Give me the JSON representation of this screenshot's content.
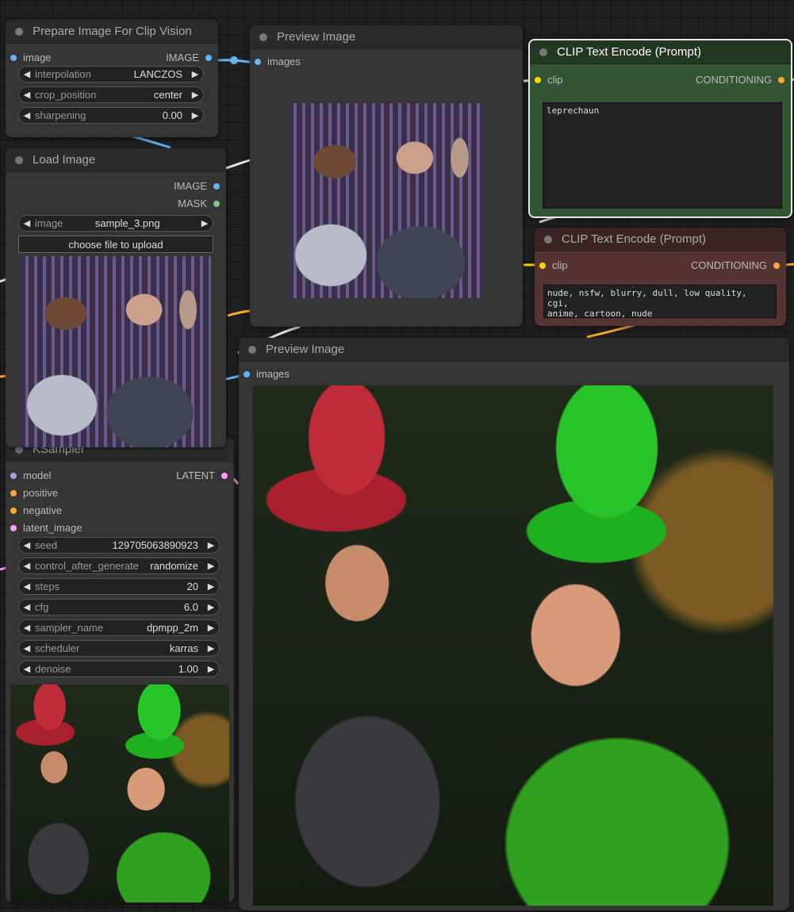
{
  "nodes": {
    "prepare_clip": {
      "title": "Prepare Image For Clip Vision",
      "input_image": "image",
      "output_image": "IMAGE",
      "widgets": [
        {
          "label": "interpolation",
          "value": "LANCZOS"
        },
        {
          "label": "crop_position",
          "value": "center"
        },
        {
          "label": "sharpening",
          "value": "0.00"
        }
      ]
    },
    "load_image": {
      "title": "Load Image",
      "output_image": "IMAGE",
      "output_mask": "MASK",
      "widgets": [
        {
          "label": "image",
          "value": "sample_3.png"
        }
      ],
      "upload_label": "choose file to upload"
    },
    "preview_top": {
      "title": "Preview Image",
      "input_images": "images"
    },
    "clip_pos": {
      "title": "CLIP Text Encode (Prompt)",
      "input_clip": "clip",
      "output": "CONDITIONING",
      "text": "leprechaun"
    },
    "clip_neg": {
      "title": "CLIP Text Encode (Prompt)",
      "input_clip": "clip",
      "output": "CONDITIONING",
      "text": "nude, nsfw, blurry, dull, low quality, cgi,\nanime, cartoon, nude"
    },
    "preview_big": {
      "title": "Preview Image",
      "input_images": "images"
    },
    "ksampler": {
      "title": "KSampler",
      "inputs": [
        "model",
        "positive",
        "negative",
        "latent_image"
      ],
      "output": "LATENT",
      "widgets": [
        {
          "label": "seed",
          "value": "129705063890923"
        },
        {
          "label": "control_after_generate",
          "value": "randomize"
        },
        {
          "label": "steps",
          "value": "20"
        },
        {
          "label": "cfg",
          "value": "6.0"
        },
        {
          "label": "sampler_name",
          "value": "dpmpp_2m"
        },
        {
          "label": "scheduler",
          "value": "karras"
        },
        {
          "label": "denoise",
          "value": "1.00"
        }
      ]
    }
  },
  "colors": {
    "image_port": "#64b5f6",
    "mask_port": "#81c784",
    "clip_port": "#ffd500",
    "conditioning_port": "#ffa931",
    "model_port": "#b39ddb",
    "latent_port": "#ff9cf9",
    "clip_pos_bg": "#335533",
    "clip_neg_bg": "#553333"
  }
}
